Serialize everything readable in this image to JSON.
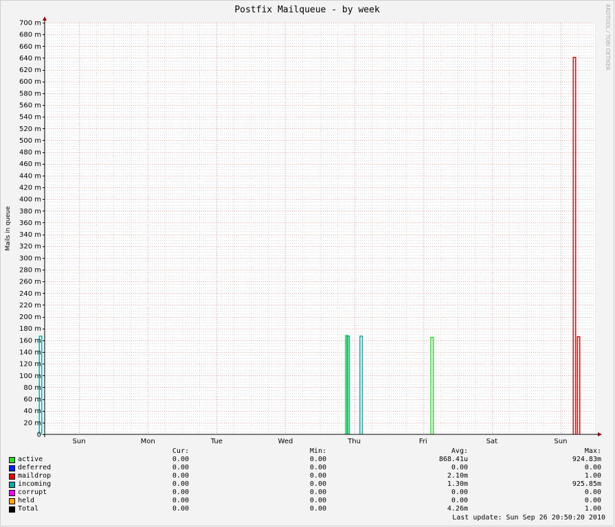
{
  "chart_data": {
    "type": "area",
    "title": "Postfix Mailqueue - by week",
    "ylabel": "Mails in queue",
    "watermark": "RRDTOOL / TOBI OETIKER",
    "ylim": [
      0,
      0.7
    ],
    "y_ticks": [
      {
        "value": 0,
        "label": "0"
      },
      {
        "value": 0.02,
        "label": "20 m"
      },
      {
        "value": 0.04,
        "label": "40 m"
      },
      {
        "value": 0.06,
        "label": "60 m"
      },
      {
        "value": 0.08,
        "label": "80 m"
      },
      {
        "value": 0.1,
        "label": "100 m"
      },
      {
        "value": 0.12,
        "label": "120 m"
      },
      {
        "value": 0.14,
        "label": "140 m"
      },
      {
        "value": 0.16,
        "label": "160 m"
      },
      {
        "value": 0.18,
        "label": "180 m"
      },
      {
        "value": 0.2,
        "label": "200 m"
      },
      {
        "value": 0.22,
        "label": "220 m"
      },
      {
        "value": 0.24,
        "label": "240 m"
      },
      {
        "value": 0.26,
        "label": "260 m"
      },
      {
        "value": 0.28,
        "label": "280 m"
      },
      {
        "value": 0.3,
        "label": "300 m"
      },
      {
        "value": 0.32,
        "label": "320 m"
      },
      {
        "value": 0.34,
        "label": "340 m"
      },
      {
        "value": 0.36,
        "label": "360 m"
      },
      {
        "value": 0.38,
        "label": "380 m"
      },
      {
        "value": 0.4,
        "label": "400 m"
      },
      {
        "value": 0.42,
        "label": "420 m"
      },
      {
        "value": 0.44,
        "label": "440 m"
      },
      {
        "value": 0.46,
        "label": "460 m"
      },
      {
        "value": 0.48,
        "label": "480 m"
      },
      {
        "value": 0.5,
        "label": "500 m"
      },
      {
        "value": 0.52,
        "label": "520 m"
      },
      {
        "value": 0.54,
        "label": "540 m"
      },
      {
        "value": 0.56,
        "label": "560 m"
      },
      {
        "value": 0.58,
        "label": "580 m"
      },
      {
        "value": 0.6,
        "label": "600 m"
      },
      {
        "value": 0.62,
        "label": "620 m"
      },
      {
        "value": 0.64,
        "label": "640 m"
      },
      {
        "value": 0.66,
        "label": "660 m"
      },
      {
        "value": 0.68,
        "label": "680 m"
      },
      {
        "value": 0.7,
        "label": "700 m"
      }
    ],
    "x_range_days": [
      0,
      8
    ],
    "day_boundaries": [
      0.5,
      1.5,
      2.5,
      3.5,
      4.5,
      5.5,
      6.5,
      7.5
    ],
    "x_ticks": [
      {
        "day": 0.5,
        "label": "Sun"
      },
      {
        "day": 1.5,
        "label": "Mon"
      },
      {
        "day": 2.5,
        "label": "Tue"
      },
      {
        "day": 3.5,
        "label": "Wed"
      },
      {
        "day": 4.5,
        "label": "Thu"
      },
      {
        "day": 5.5,
        "label": "Fri"
      },
      {
        "day": 6.5,
        "label": "Sat"
      },
      {
        "day": 7.5,
        "label": "Sun"
      }
    ],
    "series": [
      {
        "name": "active",
        "color": "#22dd22",
        "spikes": [
          {
            "day": 4.39,
            "value": 0.168
          },
          {
            "day": 5.63,
            "value": 0.165
          }
        ]
      },
      {
        "name": "deferred",
        "color": "#0022ff",
        "spikes": []
      },
      {
        "name": "maildrop",
        "color": "#ee0000",
        "spikes": [
          {
            "day": 7.7,
            "value": 0.641
          },
          {
            "day": 7.76,
            "value": 0.166
          }
        ]
      },
      {
        "name": "incoming",
        "color": "#00aaaa",
        "spikes": [
          {
            "day": -0.06,
            "value": 0.167
          },
          {
            "day": 4.41,
            "value": 0.167
          },
          {
            "day": 4.6,
            "value": 0.167
          }
        ]
      },
      {
        "name": "corrupt",
        "color": "#ff00ff",
        "spikes": []
      },
      {
        "name": "held",
        "color": "#ffa500",
        "spikes": []
      },
      {
        "name": "Total",
        "color": "#000000",
        "spikes": []
      }
    ]
  },
  "legend": {
    "headers": {
      "cur": "Cur:",
      "min": "Min:",
      "avg": "Avg:",
      "max": "Max:"
    },
    "rows": [
      {
        "name": "active",
        "color": "#22dd22",
        "cur": "0.00",
        "min": "0.00",
        "avg": "868.41u",
        "max": "924.83m"
      },
      {
        "name": "deferred",
        "color": "#0022ff",
        "cur": "0.00",
        "min": "0.00",
        "avg": "0.00",
        "max": "0.00"
      },
      {
        "name": "maildrop",
        "color": "#ee0000",
        "cur": "0.00",
        "min": "0.00",
        "avg": "2.10m",
        "max": "1.00"
      },
      {
        "name": "incoming",
        "color": "#00aaaa",
        "cur": "0.00",
        "min": "0.00",
        "avg": "1.30m",
        "max": "925.85m"
      },
      {
        "name": "corrupt",
        "color": "#ff00ff",
        "cur": "0.00",
        "min": "0.00",
        "avg": "0.00",
        "max": "0.00"
      },
      {
        "name": "held",
        "color": "#ffa500",
        "cur": "0.00",
        "min": "0.00",
        "avg": "0.00",
        "max": "0.00"
      },
      {
        "name": "Total",
        "color": "#000000",
        "cur": "0.00",
        "min": "0.00",
        "avg": "4.26m",
        "max": "1.00"
      }
    ]
  },
  "last_update": "Last update: Sun Sep 26 20:50:20 2010"
}
